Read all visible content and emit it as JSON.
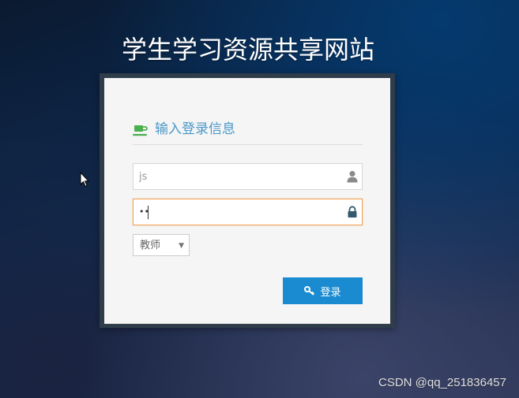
{
  "site": {
    "title": "学生学习资源共享网站"
  },
  "login": {
    "header": "输入登录信息",
    "username": {
      "value": "",
      "placeholder": "js"
    },
    "password": {
      "masked_value": "••"
    },
    "role_select": {
      "selected": "教师",
      "arrow": "▼"
    },
    "submit_label": "登录"
  },
  "watermark": "CSDN @qq_251836457",
  "colors": {
    "header_text": "#4a98c8",
    "cup_icon": "#4caf50",
    "button": "#1a8bd1",
    "focus_border": "#f0a050"
  },
  "icons": {
    "header": "coffee-cup-icon",
    "username": "user-icon",
    "password": "lock-icon",
    "button": "key-icon"
  }
}
